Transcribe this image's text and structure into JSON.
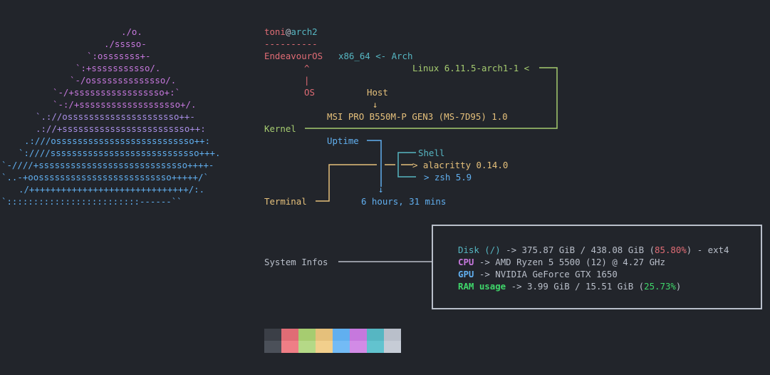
{
  "logo": {
    "lines": [
      "          ./o.",
      "        ./sssso-",
      "      `:osssssss+-",
      "    `:+sssssssssso/.",
      "  `-/ossssssssssssso/.",
      " `-/+sssssssssssssssso+:`",
      " `-:/+sssssssssssssssssso+/.",
      "`.://osssssssssssssssssssso++-",
      " .://+ssssssssssssssssssssssso++:",
      " .:///ossssssssssssssssssssssssso++:",
      "`:////ssssssssssssssssssssssssssso+++.",
      "`-////+ssssssssssssssssssssssssssso++++-",
      " `..-+oosssssssssssssssssssssssso+++++/`",
      "  ./++++++++++++++++++++++++++++++/:.",
      " `:::::::::::::::::::::::::------``"
    ]
  },
  "header": {
    "user": "toni",
    "at": "@",
    "host": "arch2",
    "separator": "----------"
  },
  "os": {
    "name": "EndeavourOS",
    "arch": "x86_64 <- Arch",
    "caret": "^",
    "pipe": "|",
    "label": "OS"
  },
  "kernel": {
    "value": "Linux 6.11.5-arch1-1 <",
    "label": "Kernel"
  },
  "host": {
    "label": "Host",
    "arrow": "↓",
    "value": "MSI PRO B550M-P GEN3 (MS-7D95) 1.0"
  },
  "uptime": {
    "label": "Uptime",
    "arrow": "↓",
    "value": "6 hours, 31 mins"
  },
  "shell": {
    "label": "Shell",
    "value": "> zsh 5.9"
  },
  "terminal": {
    "label": "Terminal",
    "value": "> alacritty 0.14.0"
  },
  "system": {
    "label": "System Infos",
    "disk_label": "Disk (/)",
    "disk_value": "-> 375.87 GiB / 438.08 GiB (",
    "disk_pct": "85.80%",
    "disk_tail": ") - ext4",
    "cpu_label": "CPU",
    "cpu_value": "-> AMD Ryzen 5 5500 (12) @ 4.27 GHz",
    "gpu_label": "GPU",
    "gpu_value": "-> NVIDIA GeForce GTX 1650",
    "ram_label": "RAM usage",
    "ram_value": "-> 3.99 GiB / 15.51 GiB (",
    "ram_pct": "25.73%",
    "ram_tail": ")"
  },
  "palette": {
    "top": [
      "#3b3f47",
      "#e06c75",
      "#a6cc70",
      "#e5c07b",
      "#61afef",
      "#c678dd",
      "#56b6c2",
      "#b9bfca"
    ],
    "bottom": [
      "#4b5059",
      "#ef7e86",
      "#b5d987",
      "#f2cf8c",
      "#73bbf5",
      "#d28be6",
      "#62c3cf",
      "#c6ccd6"
    ]
  },
  "colors": {
    "background": "#22252b",
    "logo_pink": "#c678dd",
    "logo_blue": "#61afef"
  }
}
